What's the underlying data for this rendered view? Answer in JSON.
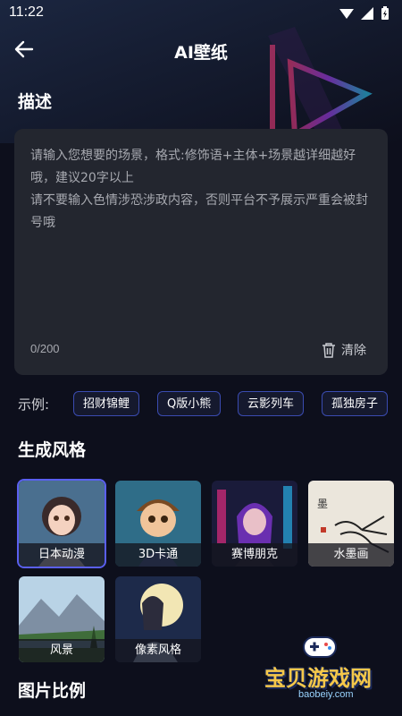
{
  "status": {
    "time": "11:22"
  },
  "header": {
    "title": "AI壁纸"
  },
  "description": {
    "heading": "描述",
    "placeholder": "请输入您想要的场景，格式:修饰语+主体+场景越详细越好哦，建议20字以上\n请不要输入色情涉恐涉政内容，否则平台不予展示严重会被封号哦",
    "counter": "0/200",
    "clear_label": "清除"
  },
  "examples": {
    "label": "示例:",
    "chips": [
      "招财锦鲤",
      "Q版小熊",
      "云影列车",
      "孤独房子"
    ]
  },
  "styles": {
    "heading": "生成风格",
    "items": [
      "日本动漫",
      "3D卡通",
      "赛博朋克",
      "水墨画",
      "风景",
      "像素风格"
    ],
    "selected": "日本动漫"
  },
  "ratio": {
    "heading": "图片比例"
  },
  "watermark": {
    "name": "宝贝游戏网",
    "domain": "baobeiy.com"
  },
  "colors": {
    "background": "#0d0f1c",
    "panel": "#23262f",
    "accent": "#5a5ff0",
    "chip_border": "#3a4bb0"
  }
}
